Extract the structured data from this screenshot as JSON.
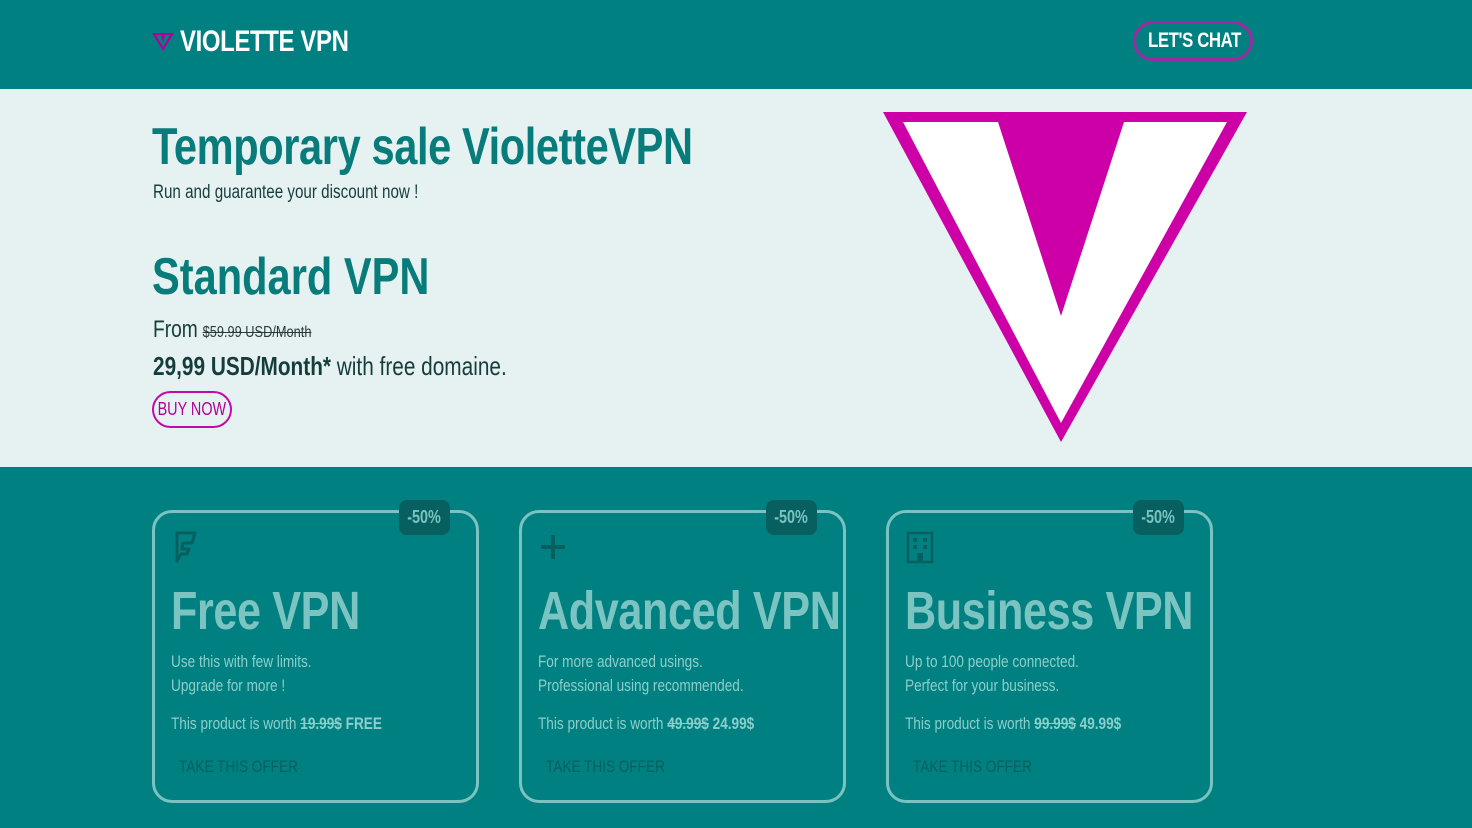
{
  "header": {
    "brand_name": "VIOLETTE VPN",
    "chat_label": "LET'S CHAT"
  },
  "hero": {
    "title": "Temporary sale VioletteVPN",
    "subtitle": "Run and guarantee your discount now !",
    "plan_title": "Standard VPN",
    "from_label": "From",
    "old_price": "$59.99 USD/Month",
    "new_price": "29,99 USD/Month*",
    "new_price_suffix": " with free domaine.",
    "buy_label": "BUY NOW"
  },
  "offers": [
    {
      "badge": "-50%",
      "icon": "foursquare-icon",
      "title": "Free VPN",
      "desc_line1": "Use this with few limits.",
      "desc_line2": "Upgrade for more !",
      "worth_label": "This product is worth",
      "old_price": "19.99$",
      "new_price": "FREE",
      "cta": "TAKE THIS OFFER"
    },
    {
      "badge": "-50%",
      "icon": "plus-icon",
      "title": "Advanced VPN",
      "desc_line1": "For more advanced usings.",
      "desc_line2": "Professional using recommended.",
      "worth_label": "This product is worth",
      "old_price": "49.99$",
      "new_price": "24.99$",
      "cta": "TAKE THIS OFFER"
    },
    {
      "badge": "-50%",
      "icon": "building-icon",
      "title": "Business VPN",
      "desc_line1": "Up to 100 people connected.",
      "desc_line2": "Perfect for your business.",
      "worth_label": "This product is worth",
      "old_price": "99.99$",
      "new_price": "49.99$",
      "cta": "TAKE THIS OFFER"
    }
  ],
  "colors": {
    "teal": "#008080",
    "hero_bg": "#e6f2f2",
    "magenta": "#cc00a6",
    "card_border": "#7ac3c0",
    "badge_bg": "#075f5f"
  }
}
